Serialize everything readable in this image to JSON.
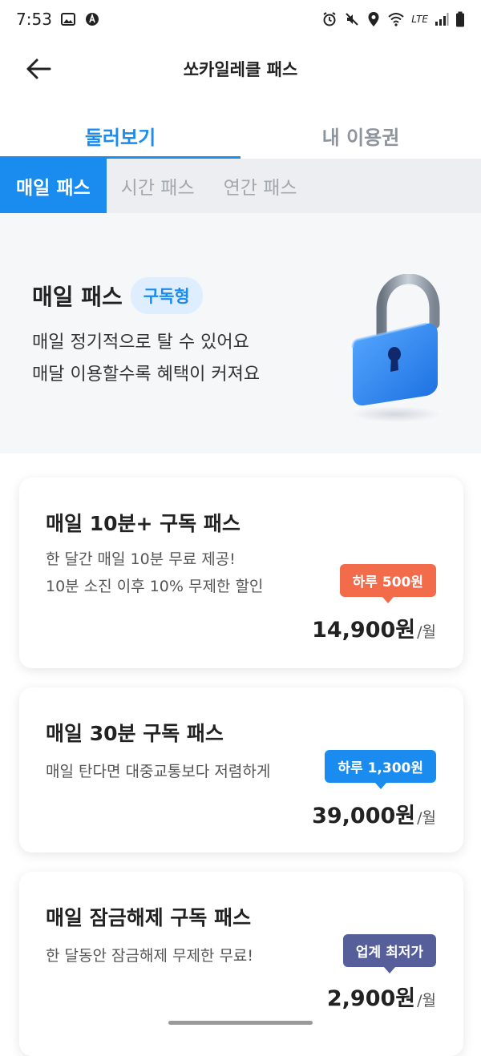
{
  "status_bar": {
    "time": "7:53",
    "lte": "LTE"
  },
  "app_bar": {
    "title": "쏘카일레클 패스"
  },
  "main_tabs": [
    {
      "label": "둘러보기"
    },
    {
      "label": "내 이용권"
    }
  ],
  "sub_tabs": [
    {
      "label": "매일 패스"
    },
    {
      "label": "시간 패스"
    },
    {
      "label": "연간 패스"
    }
  ],
  "hero": {
    "title": "매일 패스",
    "badge": "구독형",
    "desc_line1": "매일 정기적으로 탈 수 있어요",
    "desc_line2": "매달 이용할수록 혜택이 커져요"
  },
  "cards": [
    {
      "title": "매일 10분+ 구독 패스",
      "desc_line1": "한 달간 매일 10분 무료 제공!",
      "desc_line2": "10분 소진 이후 10% 무제한 할인",
      "badge": "하루 500원",
      "badge_color": "#f26b4a",
      "price": "14,900원",
      "unit": "/월"
    },
    {
      "title": "매일 30분 구독 패스",
      "desc_line1": "매일 탄다면 대중교통보다 저렴하게",
      "badge": "하루 1,300원",
      "badge_color": "#1a8cf0",
      "price": "39,000원",
      "unit": "/월"
    },
    {
      "title": "매일 잠금해제 구독 패스",
      "desc_line1": "한 달동안 잠금해제 무제한 무료!",
      "badge": "업계 최저가",
      "badge_color": "#565f99",
      "price": "2,900원",
      "unit": "/월"
    }
  ]
}
